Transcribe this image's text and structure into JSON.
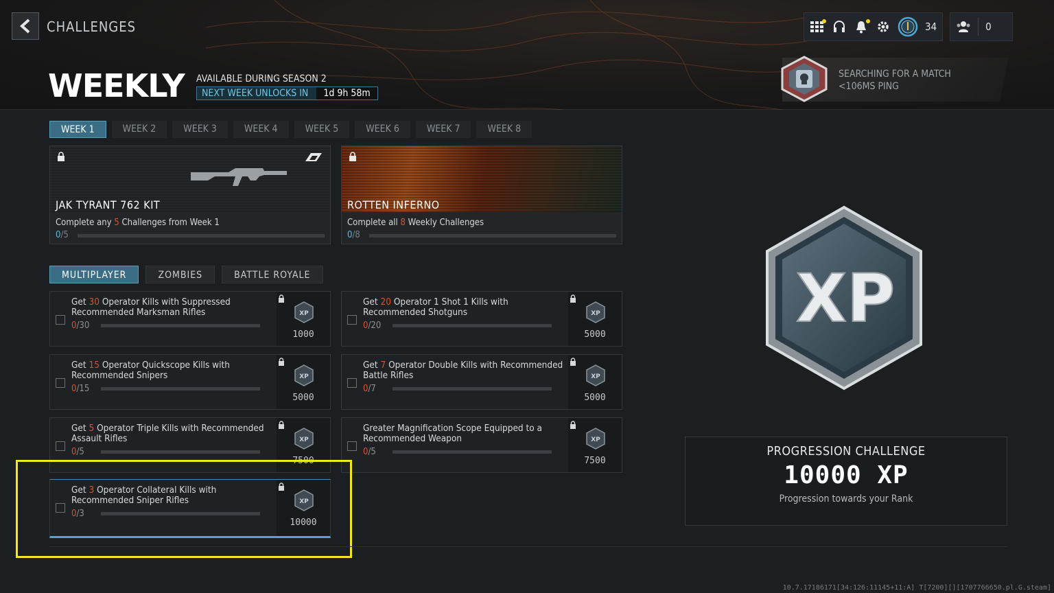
{
  "header": {
    "breadcrumb": "CHALLENGES",
    "title": "WEEKLY",
    "season_text": "AVAILABLE DURING SEASON 2",
    "unlock_label": "NEXT WEEK UNLOCKS IN",
    "unlock_time": "1d 9h 58m"
  },
  "topbar": {
    "level": "34",
    "party_count": "0",
    "icons": [
      "grid-icon",
      "headset-icon",
      "bell-icon",
      "gear-icon",
      "rank-icon",
      "party-icon"
    ]
  },
  "matchmaking": {
    "line1": "SEARCHING FOR A MATCH",
    "line2": "<106MS PING"
  },
  "week_tabs": [
    "WEEK 1",
    "WEEK 2",
    "WEEK 3",
    "WEEK 4",
    "WEEK 5",
    "WEEK 6",
    "WEEK 7",
    "WEEK 8"
  ],
  "rewards": [
    {
      "name": "JAK TYRANT 762 KIT",
      "desc_pre": "Complete any ",
      "desc_num": "5",
      "desc_post": " Challenges from Week 1",
      "done": "0",
      "total": "/5"
    },
    {
      "name": "ROTTEN INFERNO",
      "desc_pre": "Complete all ",
      "desc_num": "8",
      "desc_post": " Weekly Challenges",
      "done": "0",
      "total": "/8"
    }
  ],
  "modes": [
    "MULTIPLAYER",
    "ZOMBIES",
    "BATTLE ROYALE"
  ],
  "challenges": [
    {
      "pre": "Get ",
      "num": "30",
      "post": " Operator Kills with Suppressed Recommended Marksman Rifles",
      "done": "0",
      "total": "/30",
      "xp": "1000"
    },
    {
      "pre": "Get ",
      "num": "20",
      "post": " Operator 1 Shot 1 Kills with Recommended Shotguns",
      "done": "0",
      "total": "/20",
      "xp": "5000"
    },
    {
      "pre": "Get ",
      "num": "15",
      "post": " Operator Quickscope Kills with Recommended Snipers",
      "done": "0",
      "total": "/15",
      "xp": "5000"
    },
    {
      "pre": "Get ",
      "num": "7",
      "post": " Operator Double Kills with Recommended Battle Rifles",
      "done": "0",
      "total": "/7",
      "xp": "5000"
    },
    {
      "pre": "Get ",
      "num": "5",
      "post": " Operator Triple Kills with Recommended Assault Rifles",
      "done": "0",
      "total": "/5",
      "xp": "7500"
    },
    {
      "pre": "",
      "num": "",
      "post": "Greater Magnification Scope Equipped to a Recommended Weapon",
      "done": "0",
      "total": "/5",
      "xp": "7500"
    },
    {
      "pre": "Get ",
      "num": "3",
      "post": " Operator Collateral Kills with Recommended Sniper Rifles",
      "done": "0",
      "total": "/3",
      "xp": "10000"
    }
  ],
  "progression": {
    "title": "PROGRESSION CHALLENGE",
    "xp": "10000 XP",
    "subtitle": "Progression towards your Rank"
  },
  "footer": "10.7.17186171[34:126:11145+11:A] T[7200][][1707766650.pl.G.steam]",
  "colors": {
    "accent": "#3b6d85",
    "highlight_red": "#e0502a",
    "highlight_blue": "#5cb8e0",
    "annotation": "#f2e623"
  }
}
